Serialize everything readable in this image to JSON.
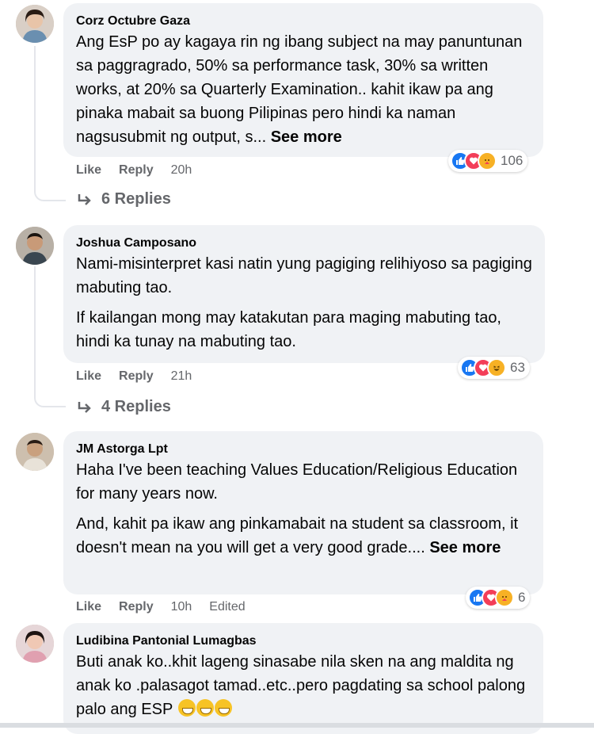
{
  "comments": [
    {
      "author": "Corz Octubre Gaza",
      "paragraphs": [
        "Ang EsP po ay kagaya rin ng ibang subject na may panuntunan sa paggragrado, 50% sa performance task, 30% sa written works, at 20% sa Quarterly Examination.. kahit ikaw pa ang pinaka mabait sa buong Pilipinas pero hindi ka naman nagsusubmit ng output, s..."
      ],
      "see_more": "See more",
      "like": "Like",
      "reply": "Reply",
      "time": "20h",
      "reaction_count": "106",
      "reactions": [
        "like-icon",
        "love-icon",
        "care-icon"
      ],
      "replies_label": "6 Replies"
    },
    {
      "author": "Joshua Camposano",
      "paragraphs": [
        "Nami-misinterpret kasi natin yung pagiging relihiyoso sa pagiging mabuting tao.",
        "If kailangan mong may katakutan para maging mabuting tao, hindi ka tunay na mabuting tao."
      ],
      "like": "Like",
      "reply": "Reply",
      "time": "21h",
      "reaction_count": "63",
      "reactions": [
        "like-icon",
        "love-icon",
        "haha-icon"
      ],
      "replies_label": "4 Replies"
    },
    {
      "author": "JM Astorga Lpt",
      "paragraphs": [
        "Haha I've been teaching Values Education/Religious Education for many years now.",
        "And, kahit pa ikaw ang pinkamabait na student sa classroom, it doesn't mean na you will get a very good grade...."
      ],
      "see_more": "See more",
      "like": "Like",
      "reply": "Reply",
      "time": "10h",
      "edited": "Edited",
      "reaction_count": "6",
      "reactions": [
        "like-icon",
        "love-icon",
        "care-icon"
      ]
    },
    {
      "author": "Ludibina Pantonial Lumagbas",
      "paragraphs": [
        "Buti anak ko..khit lageng sinasabe nila sken na ang maldita ng anak ko .palasagot tamad..etc..pero pagdating sa school palong palo ang ESP"
      ],
      "emojis": [
        "grin-emoji",
        "grin-emoji",
        "grin-emoji"
      ]
    }
  ],
  "colors": {
    "bubble": "#f0f2f5",
    "meta": "#65676b",
    "like": "#1877f2",
    "love": "#f33e58",
    "haha": "#f7b125"
  }
}
